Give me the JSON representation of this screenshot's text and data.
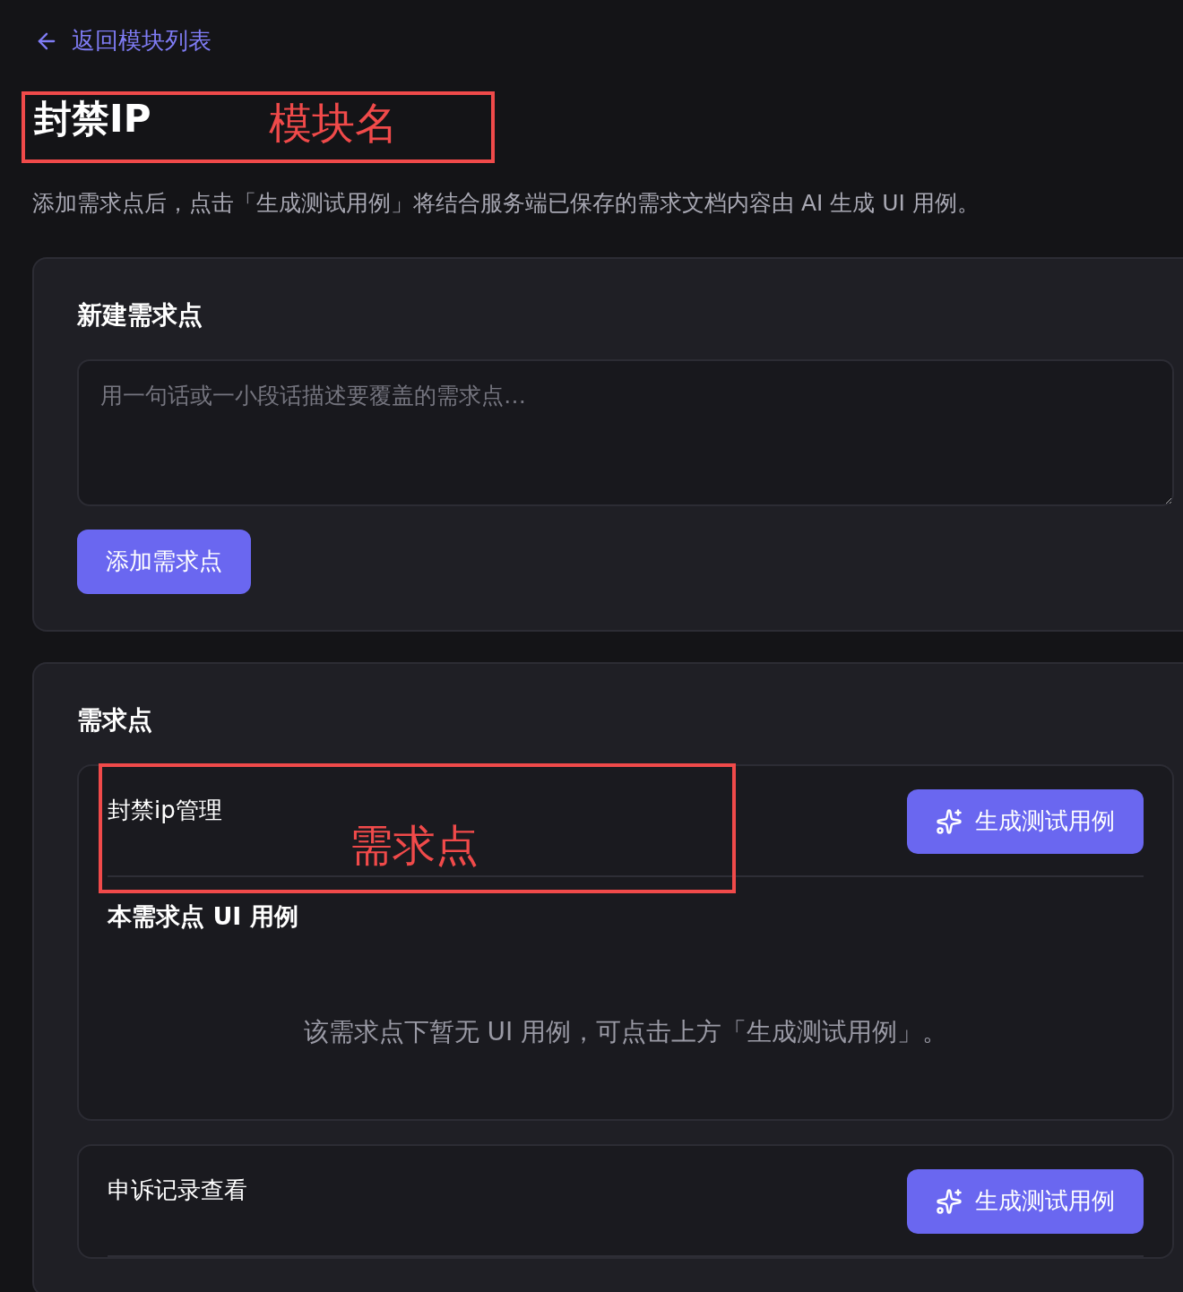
{
  "back_link": {
    "label": "返回模块列表"
  },
  "module": {
    "title": "封禁IP"
  },
  "description": "添加需求点后，点击「生成测试用例」将结合服务端已保存的需求文档内容由 AI 生成 UI 用例。",
  "new_requirement": {
    "title": "新建需求点",
    "placeholder": "用一句话或一小段话描述要覆盖的需求点…",
    "button": "添加需求点"
  },
  "requirements": {
    "title": "需求点",
    "items": [
      {
        "name": "封禁ip管理",
        "button": "生成测试用例",
        "cases_title": "本需求点 UI 用例",
        "empty_text": "该需求点下暂无 UI 用例，可点击上方「生成测试用例」。"
      },
      {
        "name": "申诉记录查看",
        "button": "生成测试用例"
      }
    ]
  },
  "annotations": [
    {
      "label": "模块名"
    },
    {
      "label": "需求点"
    }
  ]
}
